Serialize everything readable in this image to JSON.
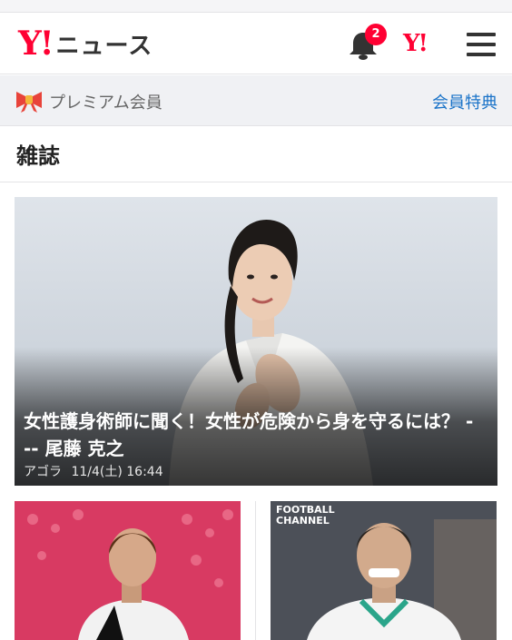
{
  "header": {
    "logo_y": "Y!",
    "logo_news": "ニュース",
    "notification_count": "2",
    "yahoo_icon": "Y!"
  },
  "premium": {
    "label": "プレミアム会員",
    "link": "会員特典",
    "icon": "ribbon-icon"
  },
  "section": {
    "title": "雑誌"
  },
  "hero": {
    "title": "女性護身術師に聞く！女性が危険から身を守るには？ --- 尾藤 克之",
    "source": "アゴラ",
    "timestamp": "11/4(土) 16:44"
  },
  "thumbs": [
    {
      "brand": ""
    },
    {
      "brand_line1": "FOOTBALL",
      "brand_line2": "CHANNEL"
    }
  ],
  "colors": {
    "brand_red": "#ff0033",
    "link_blue": "#1a73c8"
  }
}
